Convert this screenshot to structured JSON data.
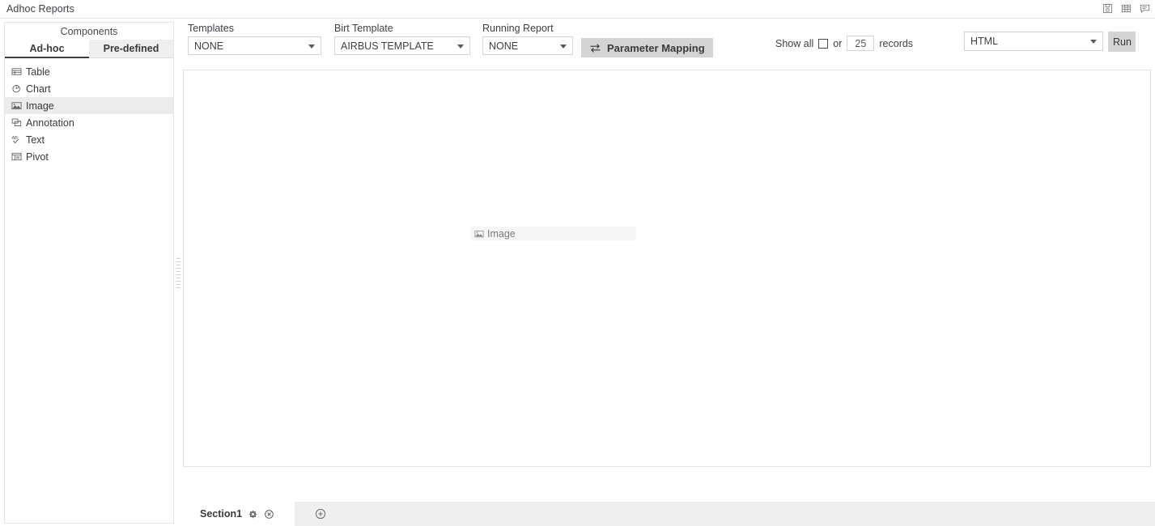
{
  "titlebar": {
    "title": "Adhoc Reports",
    "icons": [
      {
        "name": "save-icon",
        "label": "Save"
      },
      {
        "name": "table-icon",
        "label": "Table"
      },
      {
        "name": "comment-icon",
        "label": "Comment"
      }
    ]
  },
  "sidebar": {
    "header": "Components",
    "tabs": [
      {
        "label": "Ad-hoc",
        "active": true
      },
      {
        "label": "Pre-defined",
        "active": false
      }
    ],
    "items": [
      {
        "label": "Table",
        "icon": "table-icon",
        "selected": false
      },
      {
        "label": "Chart",
        "icon": "chart-pie-icon",
        "selected": false
      },
      {
        "label": "Image",
        "icon": "image-icon",
        "selected": true
      },
      {
        "label": "Annotation",
        "icon": "annotation-icon",
        "selected": false
      },
      {
        "label": "Text",
        "icon": "text-abc-icon",
        "selected": false
      },
      {
        "label": "Pivot",
        "icon": "pivot-icon",
        "selected": false
      }
    ]
  },
  "toolbar": {
    "templates": {
      "label": "Templates",
      "value": "NONE"
    },
    "birt_template": {
      "label": "Birt Template",
      "value": "AIRBUS TEMPLATE"
    },
    "running_report": {
      "label": "Running Report",
      "value": "NONE"
    },
    "parameter_mapping_label": "Parameter Mapping",
    "show_all_label": "Show all",
    "or_label": "or",
    "records_value": "25",
    "records_label": "records",
    "format": {
      "value": "HTML"
    },
    "run_label": "Run"
  },
  "canvas": {
    "placeholder_label": "Image"
  },
  "sections": {
    "tabs": [
      {
        "label": "Section1",
        "active": true
      }
    ],
    "add_label": "+"
  },
  "colors": {
    "accent": "#3c3c3c",
    "button_bg": "#d4d4d4",
    "selected_row": "#ececec",
    "panel_border": "#e6e6e6",
    "text": "#3f3f46"
  }
}
